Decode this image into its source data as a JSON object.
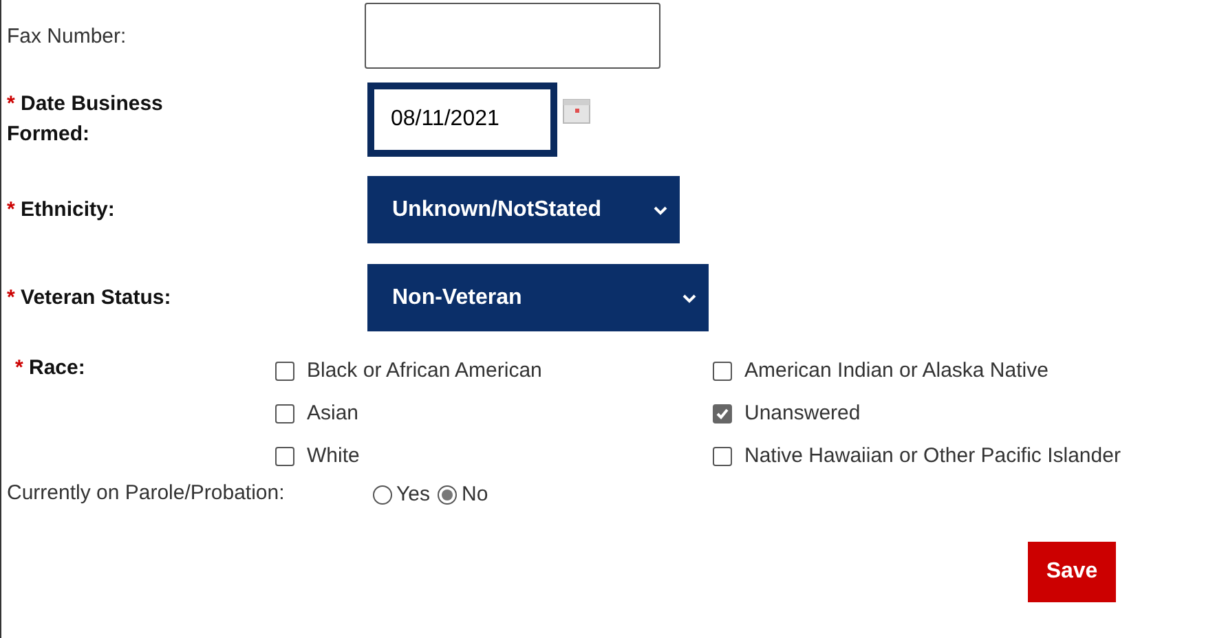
{
  "fax": {
    "label": "Fax Number:"
  },
  "date_formed": {
    "required_mark": "*",
    "label": "Date Business Formed:",
    "value": "08/11/2021"
  },
  "ethnicity": {
    "required_mark": "*",
    "label": "Ethnicity:",
    "value": "Unknown/NotStated"
  },
  "veteran_status": {
    "required_mark": "*",
    "label": "Veteran Status:",
    "value": "Non-Veteran"
  },
  "race": {
    "required_mark": "*",
    "label": "Race:",
    "options": [
      {
        "label": "Black or African American",
        "checked": false
      },
      {
        "label": "American Indian or Alaska Native",
        "checked": false
      },
      {
        "label": "Asian",
        "checked": false
      },
      {
        "label": "Unanswered",
        "checked": true
      },
      {
        "label": "White",
        "checked": false
      },
      {
        "label": "Native Hawaiian or Other Pacific Islander",
        "checked": false
      }
    ]
  },
  "parole": {
    "label": "Currently on Parole/Probation:",
    "options": [
      {
        "label": "Yes",
        "selected": false
      },
      {
        "label": "No",
        "selected": true
      }
    ]
  },
  "buttons": [
    "Save"
  ]
}
